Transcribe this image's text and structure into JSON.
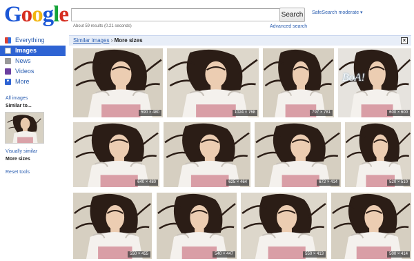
{
  "logo": {
    "letters": [
      "G",
      "o",
      "o",
      "g",
      "l",
      "e"
    ],
    "colors": [
      "#1a56d6",
      "#d62d20",
      "#f2b50f",
      "#1a56d6",
      "#15a339",
      "#d62d20"
    ]
  },
  "search": {
    "value": "",
    "button_label": "Search",
    "safesearch": "SafeSearch moderate ▾",
    "results_count": "About 59 results (0.21 seconds)",
    "advanced_link": "Advanced search"
  },
  "sidebar": {
    "items": [
      {
        "label": "Everything",
        "icon": "everything-icon"
      },
      {
        "label": "Images",
        "icon": "images-icon"
      },
      {
        "label": "News",
        "icon": "news-icon"
      },
      {
        "label": "Videos",
        "icon": "videos-icon"
      },
      {
        "label": "More",
        "icon": "more-icon"
      }
    ],
    "all_images": "All images",
    "similar_to": "Similar to...",
    "visually_similar": "Visually similar",
    "more_sizes": "More sizes",
    "reset_tools": "Reset tools"
  },
  "header": {
    "similar_link": "Similar images",
    "separator": "›",
    "current": "More sizes",
    "close": "×"
  },
  "thumbnails": [
    {
      "dims": "590 × 480"
    },
    {
      "dims": "1024 × 768"
    },
    {
      "dims": "797 × 781"
    },
    {
      "dims": "600 × 600",
      "watermark": "BoA!"
    },
    {
      "dims": "640 × 480"
    },
    {
      "dims": "625 × 464"
    },
    {
      "dims": "672 × 414"
    },
    {
      "dims": "520 × 510"
    },
    {
      "dims": "550 × 455"
    },
    {
      "dims": "540 × 447"
    },
    {
      "dims": "550 × 413"
    },
    {
      "dims": "500 × 414"
    }
  ]
}
